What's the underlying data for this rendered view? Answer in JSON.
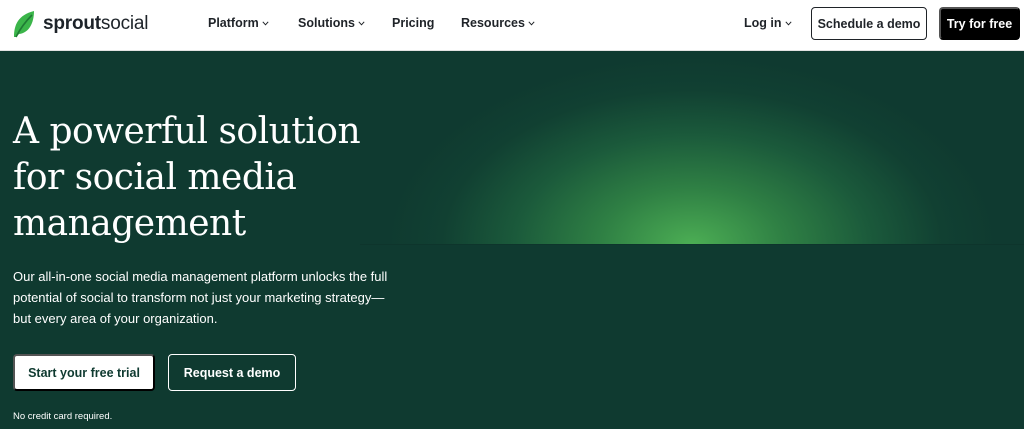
{
  "brand": {
    "name_bold": "sprout",
    "name_regular": "social",
    "logo_icon": "sprout-leaf-icon",
    "logo_color": "#3bb54a"
  },
  "nav": {
    "items": [
      {
        "label": "Platform",
        "dropdown": true
      },
      {
        "label": "Solutions",
        "dropdown": true
      },
      {
        "label": "Pricing",
        "dropdown": false
      },
      {
        "label": "Resources",
        "dropdown": true
      }
    ],
    "login": "Log in",
    "schedule_demo": "Schedule a demo",
    "try_free": "Try for free"
  },
  "hero": {
    "headline_lines": [
      "A powerful solution",
      "for social media",
      "management"
    ],
    "subtext_lines": [
      "Our all-in-one social media management platform unlocks the full",
      "potential of social to transform not just your marketing strategy—",
      "but every area of your organization."
    ],
    "primary_cta": "Start your free trial",
    "secondary_cta": "Request a demo",
    "note": "No credit card required."
  },
  "colors": {
    "hero_bg": "#0f3a30",
    "glow_center": "#4cae54",
    "nav_bg": "#ffffff",
    "text_dark": "#1f2328",
    "cta_dark": "#000000"
  }
}
